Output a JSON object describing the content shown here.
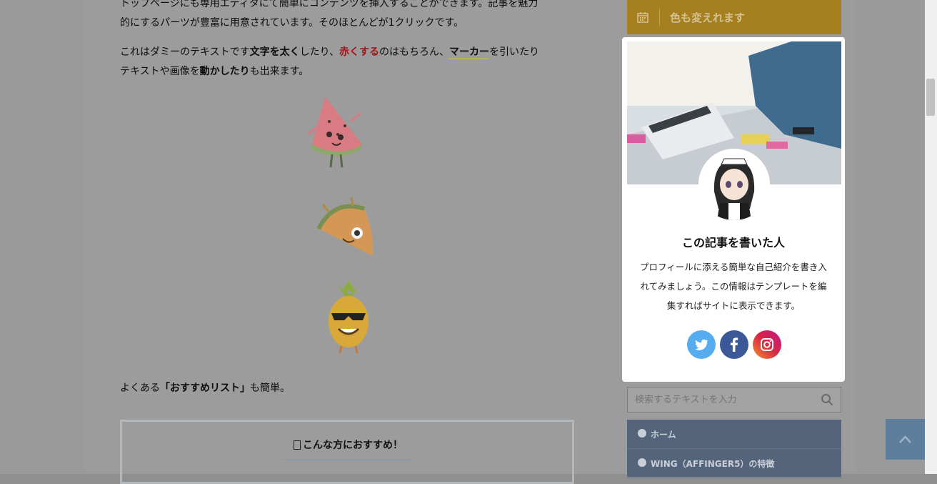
{
  "article": {
    "intro_line1": "トップページにも専用エディタにて簡単にコンテンツを挿入することができます。記事を魅力",
    "intro_line2": "的にするパーツが豊富に用意されています。そのほとんどが1クリックです。",
    "dummy": {
      "p1": "これはダミーのテキストです",
      "bold1": "文字を太く",
      "p2": "したり、",
      "red": "赤くする",
      "p3": "のはもちろん、",
      "marker": "マーカー",
      "p4": "を引いたり",
      "p5": "テキストや画像を",
      "bold2": "動かしたり",
      "p6": "も出来ます。"
    },
    "rec": {
      "p1": "よくある",
      "bold": "「おすすめリスト」",
      "p2": "も簡単。"
    },
    "rec_box_title": "こんな方におすすめ！"
  },
  "sidebar": {
    "widget_title": "色も変えれます",
    "profile": {
      "title": "この記事を書いた人",
      "description": "プロフィールに添える簡単な自己紹介を書き入れてみましょう。この情報はテンプレートを編集すればサイトに表示できます。",
      "social": [
        "twitter-icon",
        "facebook-icon",
        "instagram-icon"
      ]
    },
    "search_placeholder": "検索するテキストを入力",
    "nav": [
      {
        "label": "ホーム"
      },
      {
        "label": "WING（AFFINGER5）の特徴"
      }
    ]
  },
  "colors": {
    "widget_bar": "#a6801e",
    "nav_bg": "#54657b",
    "red_text": "#a2171a",
    "twitter": "#55acee",
    "facebook": "#3b5998"
  }
}
